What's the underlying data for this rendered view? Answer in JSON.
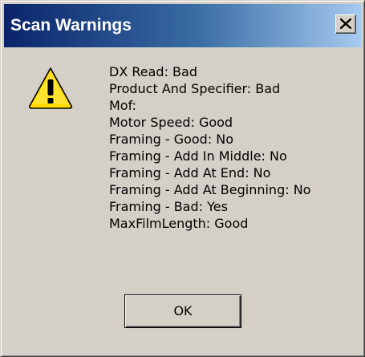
{
  "window": {
    "title": "Scan Warnings"
  },
  "title_bar": {
    "close_icon": "close-icon",
    "gradient_colors": [
      "#0a246a",
      "#a6caf0"
    ]
  },
  "dialog": {
    "icon": "warning-icon",
    "messages": [
      "DX Read: Bad",
      "Product And Specifier: Bad",
      "Mof:",
      "Motor Speed: Good",
      "Framing - Good: No",
      "Framing - Add In Middle: No",
      "Framing - Add At End: No",
      "Framing - Add At Beginning: No",
      "Framing - Bad: Yes",
      "MaxFilmLength: Good"
    ],
    "ok_label": "OK"
  },
  "colors": {
    "face": "#d4d0c8",
    "warning_yellow": "#ffd800"
  }
}
